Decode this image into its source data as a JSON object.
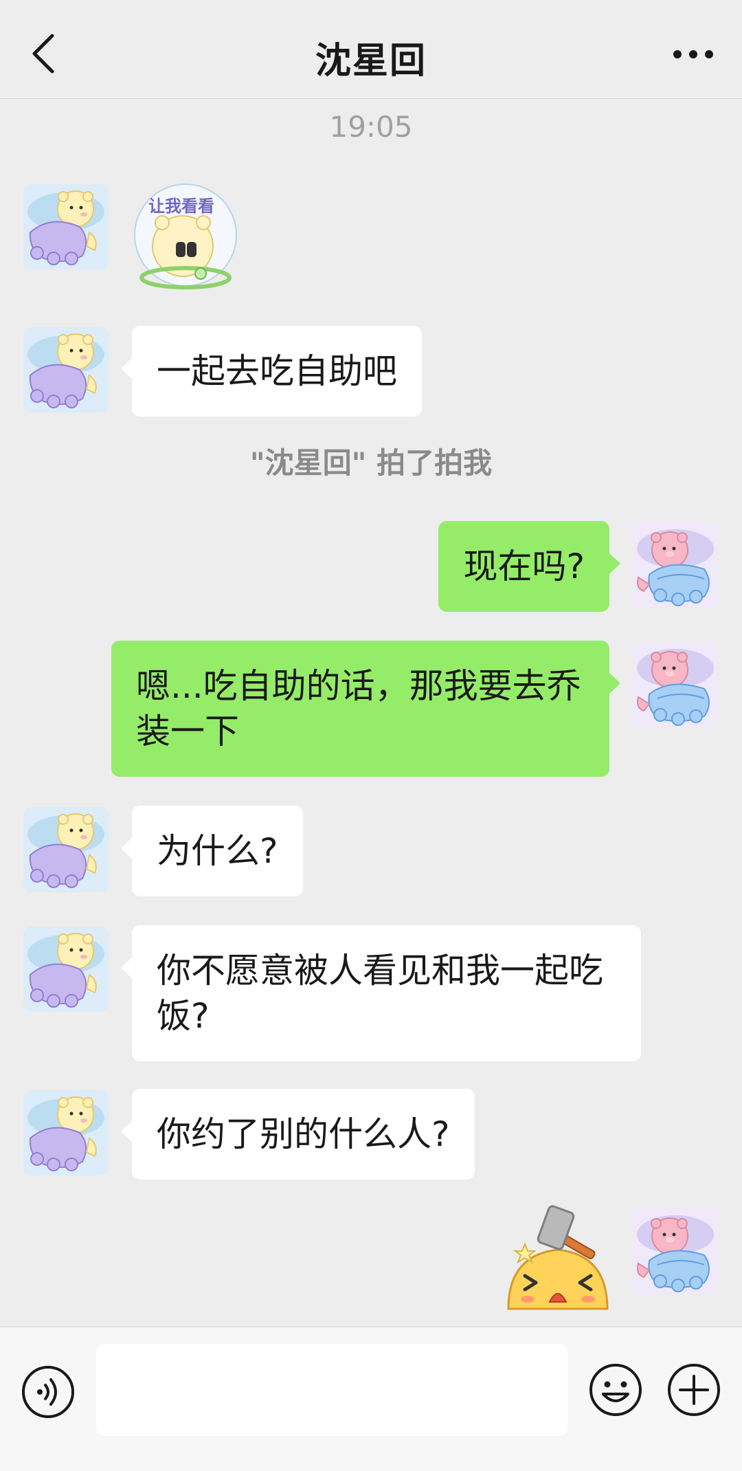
{
  "header": {
    "title": "沈星回",
    "back_icon": "chevron-left-icon",
    "more_icon": "more-horizontal-icon"
  },
  "timestamp": "19:05",
  "messages": [
    {
      "side": "left",
      "type": "sticker",
      "sticker_text": "让我看看"
    },
    {
      "side": "left",
      "type": "text",
      "text": "一起去吃自助吧"
    },
    {
      "side": "right",
      "type": "text",
      "text": "现在吗?"
    },
    {
      "side": "right",
      "type": "text",
      "text": "嗯...吃自助的话，那我要去乔装一下"
    },
    {
      "side": "left",
      "type": "text",
      "text": "为什么?"
    },
    {
      "side": "left",
      "type": "text",
      "text": "你不愿意被人看见和我一起吃饭?"
    },
    {
      "side": "left",
      "type": "text",
      "text": "你约了别的什么人?"
    },
    {
      "side": "right",
      "type": "sticker",
      "sticker_name": "hammer-bonk-sticker"
    }
  ],
  "system_notice": "\"沈星回\" 拍了拍我",
  "input_bar": {
    "voice_icon": "voice-icon",
    "emoji_icon": "emoji-icon",
    "plus_icon": "plus-circle-icon",
    "text_value": ""
  },
  "colors": {
    "background": "#ededed",
    "bubble_self": "#95ec69",
    "bubble_other": "#ffffff"
  }
}
